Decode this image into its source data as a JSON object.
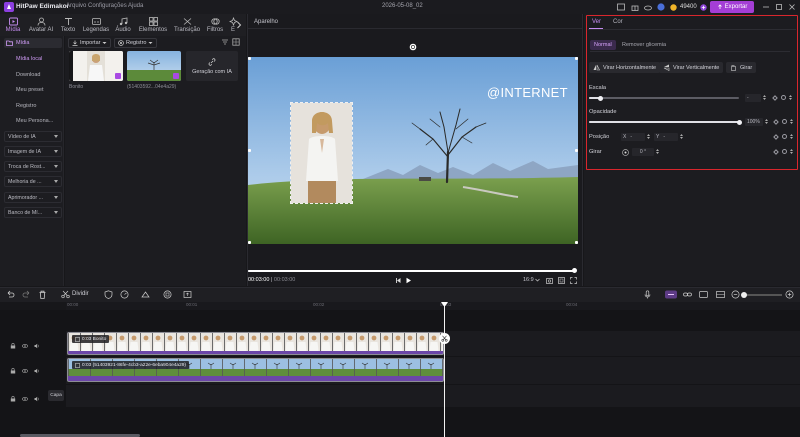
{
  "app": {
    "name": "HitPaw Edimakor",
    "menu": [
      "Arquivo",
      "Configurações",
      "Ajuda"
    ],
    "project_name": "2026-05-08_02",
    "credits": "49400",
    "export_label": "Exportar",
    "accent": "#a43ed6"
  },
  "top_tabs": [
    {
      "label": "Mídia",
      "icon": "media-icon",
      "active": true
    },
    {
      "label": "Avatar AI",
      "icon": "avatar-icon"
    },
    {
      "label": "Texto",
      "icon": "text-icon"
    },
    {
      "label": "Legendas",
      "icon": "captions-icon"
    },
    {
      "label": "Áudio",
      "icon": "music-icon"
    },
    {
      "label": "Elementos",
      "icon": "elements-icon"
    },
    {
      "label": "Transição",
      "icon": "transition-icon"
    },
    {
      "label": "Filtros",
      "icon": "filter-icon"
    },
    {
      "label": "E",
      "icon": "effects-icon"
    }
  ],
  "sidebar": {
    "section": "Mídia",
    "subitems": [
      "Mídia local",
      "Download",
      "Meu preset",
      "Registro",
      "Meu Persona..."
    ],
    "groups": [
      "Vídeo de IA",
      "Imagem de IA",
      "Troca de Rost...",
      "Melhoria de ...",
      "Aprimorador ...",
      "Banco de Mí..."
    ]
  },
  "media": {
    "import_label": "Importar",
    "record_label": "Registro",
    "items": [
      {
        "label": "Bonito"
      },
      {
        "label": "(51403592...04e4a29)"
      },
      {
        "label": "Geração com IA"
      }
    ]
  },
  "preview": {
    "title": "Aparelho",
    "watermark": "@INTERNET",
    "timecode_current": "00:03:00",
    "timecode_total": "00:03:00",
    "aspect_ratio": "16:9",
    "progress": 1.0
  },
  "properties": {
    "tabs": [
      "Ver",
      "Cor"
    ],
    "active_tab": "Ver",
    "mode_tabs": [
      "Normal",
      "Remover glicemia"
    ],
    "buttons": [
      "Virar Horizontalmente",
      "Virar Verticalmente",
      "Girar"
    ],
    "scale": {
      "label": "Escala",
      "value": "-",
      "fraction": 0.07
    },
    "opacity": {
      "label": "Opacidade",
      "value": "100%",
      "fraction": 1.0
    },
    "position": {
      "label": "Posição",
      "x_label": "X",
      "x_value": "-",
      "y_label": "Y",
      "y_value": "-"
    },
    "rotate": {
      "label": "Girar",
      "value": "0 °"
    },
    "outline_color": "#d9262d"
  },
  "timeline": {
    "split_label": "Dividir",
    "ruler": [
      "00:00",
      "00:01",
      "00:02",
      "00:03",
      "00:04"
    ],
    "clip1_label": "0:03 Bonito",
    "clip2_label": "0:03 (51403921-86fe-4cb3-a22e-6eba904e4a29)",
    "caption_track_label": "Capa",
    "clip_color": "#6b46a8"
  }
}
